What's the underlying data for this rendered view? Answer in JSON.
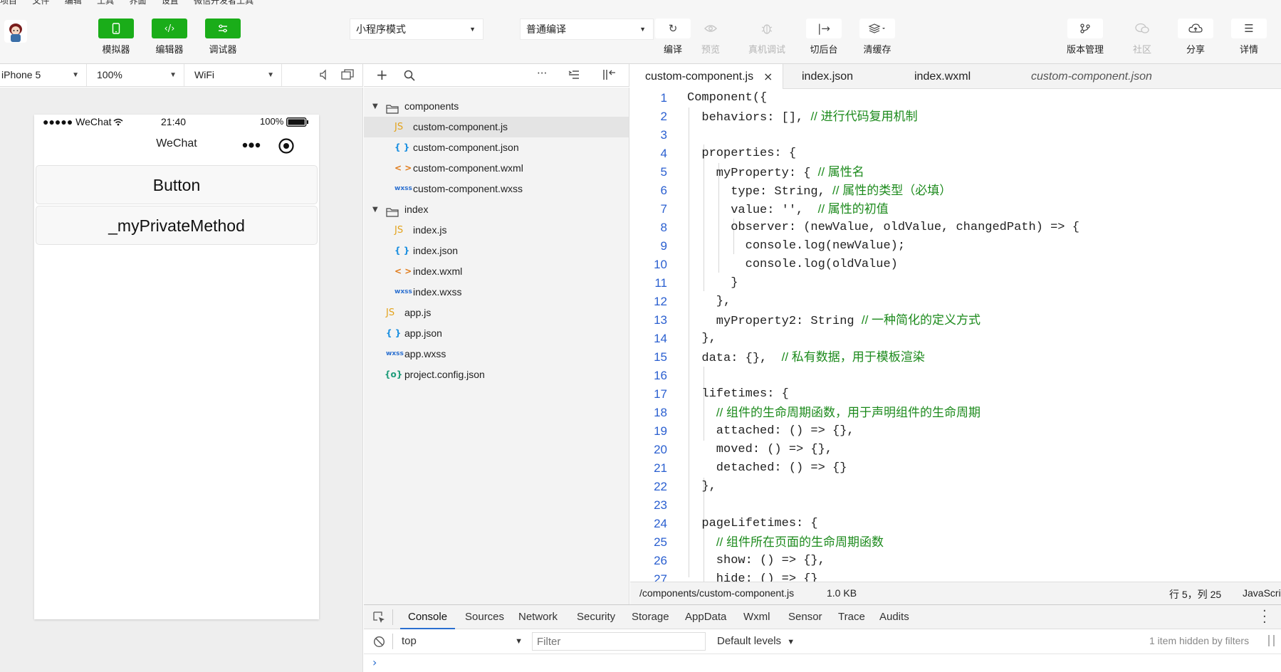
{
  "menu": [
    "项目",
    "文件",
    "编辑",
    "工具",
    "界面",
    "设置",
    "微信开发者工具"
  ],
  "toolbar": {
    "simulator": "模拟器",
    "editor": "编辑器",
    "debugger": "调试器",
    "mode_select": "小程序模式",
    "compile_select": "普通编译",
    "compile": "编译",
    "preview": "预览",
    "remote_debug": "真机调试",
    "background": "切后台",
    "clear_cache": "清缓存",
    "version": "版本管理",
    "community": "社区",
    "share": "分享",
    "details": "详情"
  },
  "simulator": {
    "device": "iPhone 5",
    "zoom": "100%",
    "network": "WiFi",
    "status_carrier": "●●●●● WeChat",
    "status_time": "21:40",
    "status_battery": "100%",
    "nav_title": "WeChat",
    "buttons": [
      "Button",
      "_myPrivateMethod"
    ]
  },
  "explorer": {
    "tree": [
      {
        "label": "components",
        "type": "folder"
      },
      {
        "label": "custom-component.js",
        "type": "js"
      },
      {
        "label": "custom-component.json",
        "type": "json"
      },
      {
        "label": "custom-component.wxml",
        "type": "wxml"
      },
      {
        "label": "custom-component.wxss",
        "type": "wxss"
      },
      {
        "label": "index",
        "type": "folder"
      },
      {
        "label": "index.js",
        "type": "js"
      },
      {
        "label": "index.json",
        "type": "json"
      },
      {
        "label": "index.wxml",
        "type": "wxml"
      },
      {
        "label": "index.wxss",
        "type": "wxss"
      },
      {
        "label": "app.js",
        "type": "js"
      },
      {
        "label": "app.json",
        "type": "json"
      },
      {
        "label": "app.wxss",
        "type": "wxss"
      },
      {
        "label": "project.config.json",
        "type": "config"
      }
    ]
  },
  "editor": {
    "tabs": [
      "custom-component.js",
      "index.json",
      "index.wxml",
      "custom-component.json"
    ],
    "lines": [
      {
        "n": "1",
        "code": "Component({",
        "comment": ""
      },
      {
        "n": "2",
        "code": "  behaviors: [], ",
        "comment": "// 进行代码复用机制"
      },
      {
        "n": "3",
        "code": "",
        "comment": ""
      },
      {
        "n": "4",
        "code": "  properties: {",
        "comment": ""
      },
      {
        "n": "5",
        "code": "    myProperty: { ",
        "comment": "// 属性名"
      },
      {
        "n": "6",
        "code": "      type: String, ",
        "comment": "// 属性的类型（必填）"
      },
      {
        "n": "7",
        "code": "      value: '',  ",
        "comment": "// 属性的初值"
      },
      {
        "n": "8",
        "code": "      observer: (newValue, oldValue, changedPath) => {",
        "comment": ""
      },
      {
        "n": "9",
        "code": "        console.log(newValue);",
        "comment": ""
      },
      {
        "n": "10",
        "code": "        console.log(oldValue)",
        "comment": ""
      },
      {
        "n": "11",
        "code": "      }",
        "comment": ""
      },
      {
        "n": "12",
        "code": "    },",
        "comment": ""
      },
      {
        "n": "13",
        "code": "    myProperty2: String ",
        "comment": "// 一种简化的定义方式"
      },
      {
        "n": "14",
        "code": "  },",
        "comment": ""
      },
      {
        "n": "15",
        "code": "  data: {},  ",
        "comment": "// 私有数据，用于模板渲染"
      },
      {
        "n": "16",
        "code": "",
        "comment": ""
      },
      {
        "n": "17",
        "code": "  lifetimes: {",
        "comment": ""
      },
      {
        "n": "18",
        "code": "    ",
        "comment": "// 组件的生命周期函数，用于声明组件的生命周期"
      },
      {
        "n": "19",
        "code": "    attached: () => {},",
        "comment": ""
      },
      {
        "n": "20",
        "code": "    moved: () => {},",
        "comment": ""
      },
      {
        "n": "21",
        "code": "    detached: () => {}",
        "comment": ""
      },
      {
        "n": "22",
        "code": "  },",
        "comment": ""
      },
      {
        "n": "23",
        "code": "",
        "comment": ""
      },
      {
        "n": "24",
        "code": "  pageLifetimes: {",
        "comment": ""
      },
      {
        "n": "25",
        "code": "    ",
        "comment": "// 组件所在页面的生命周期函数"
      },
      {
        "n": "26",
        "code": "    show: () => {},",
        "comment": ""
      },
      {
        "n": "27",
        "code": "    hide: () => {}",
        "comment": ""
      }
    ],
    "status_path": "/components/custom-component.js",
    "status_size": "1.0 KB",
    "status_position": "行 5，列 25",
    "status_lang": "JavaScript"
  },
  "console": {
    "tabs": [
      "Console",
      "Sources",
      "Network",
      "Security",
      "Storage",
      "AppData",
      "Wxml",
      "Sensor",
      "Trace",
      "Audits"
    ],
    "context": "top",
    "filter_placeholder": "Filter",
    "levels": "Default levels",
    "hidden_note": "1 item hidden by filters",
    "prompt": "›"
  },
  "colors": {
    "accent_green": "#1aad19",
    "comment_green": "#1c8a1c",
    "keyword_blue": "#1b45b8",
    "line_number_blue": "#2a5fd0"
  }
}
